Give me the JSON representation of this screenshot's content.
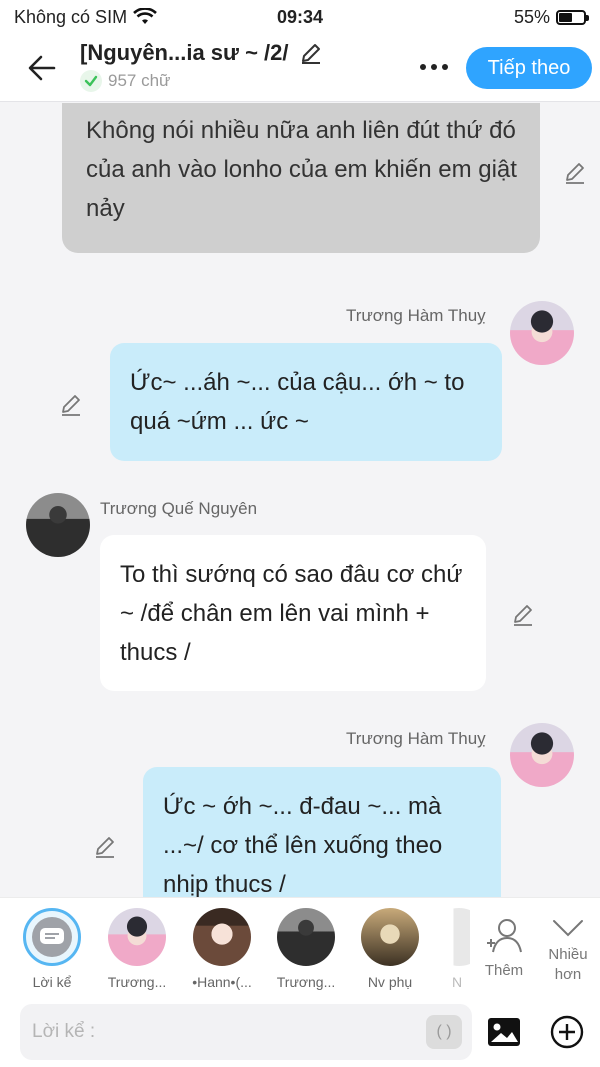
{
  "status_bar": {
    "carrier": "Không có SIM",
    "time": "09:34",
    "battery_percent": "55%",
    "battery_level": 0.55
  },
  "header": {
    "title": "[Nguyên...ia sư ~ /2/",
    "word_count": "957 chữ",
    "next_label": "Tiếp theo"
  },
  "messages": [
    {
      "text": "Không nói nhiều nữa anh liên đút thứ đó của anh vào lonho của em khiến em giật nảy"
    },
    {
      "name": "Trương Hàm Thuỵ",
      "text": "Ức~ ...áh ~... của cậu... ớh ~ to quá ~ứm ... ức ~"
    },
    {
      "name": "Trương Quế Nguyên",
      "text": "To thì sướnq có sao đâu cơ chứ ~ /để chân em lên vai mình + thucs /"
    },
    {
      "name": "Trương Hàm Thuỵ",
      "text": "Ức ~ ớh ~... đ-đau ~... mà ...~/ cơ thể lên xuống theo nhịp thucs /"
    }
  ],
  "characters": [
    {
      "label": "Lời kể"
    },
    {
      "label": "Trương..."
    },
    {
      "label": "•Hann•(..."
    },
    {
      "label": "Trương..."
    },
    {
      "label": "Nv phụ"
    },
    {
      "label": "N"
    }
  ],
  "add_label": "Thêm",
  "more_label": "Nhiều hơn",
  "composer": {
    "placeholder": "Lời kể :",
    "bracket_label": "( )"
  },
  "colors": {
    "accent": "#2fa4ff",
    "bubble_blue": "#c9ecfa",
    "bubble_gray": "#cfcfcf",
    "check_green": "#3cc25a"
  }
}
